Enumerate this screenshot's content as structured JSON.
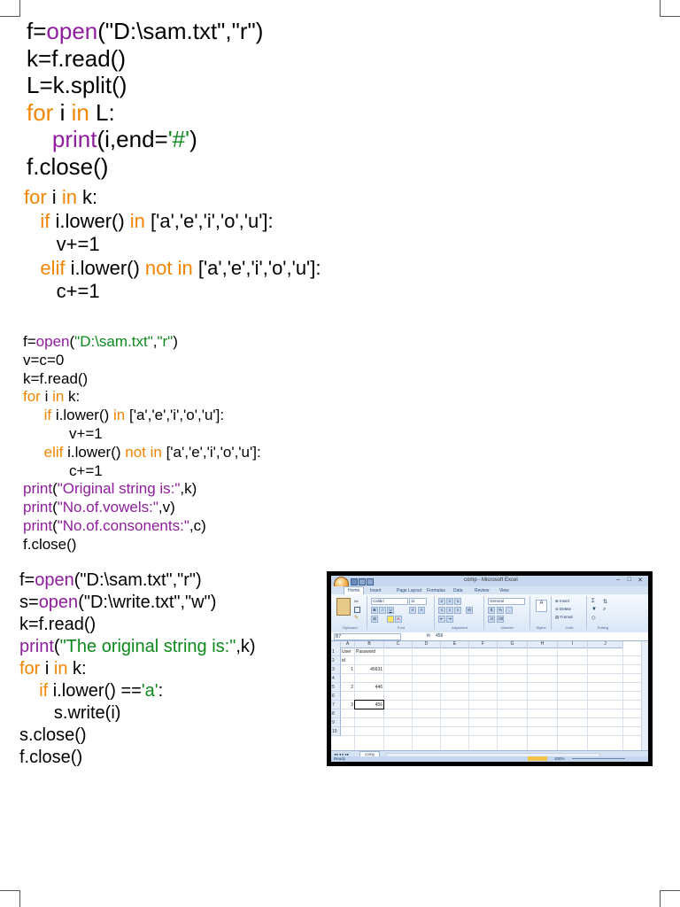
{
  "code_blocks": [
    {
      "lines": [
        [
          {
            "t": "f=",
            "c": "k"
          },
          {
            "t": "open",
            "c": "fn"
          },
          {
            "t": "(\"D:\\sam.txt\",\"r\")",
            "c": "k"
          }
        ],
        [
          {
            "t": "k=f.read()",
            "c": "k"
          }
        ],
        [
          {
            "t": "L=k.split()",
            "c": "k"
          }
        ],
        [
          {
            "t": "for",
            "c": "kw"
          },
          {
            "t": " i ",
            "c": "k"
          },
          {
            "t": "in",
            "c": "kw"
          },
          {
            "t": " L:",
            "c": "k"
          }
        ],
        [
          {
            "t": "    ",
            "c": "k"
          },
          {
            "t": "print",
            "c": "fn"
          },
          {
            "t": "(i,end=",
            "c": "k"
          },
          {
            "t": "'#'",
            "c": "str"
          },
          {
            "t": ")",
            "c": "k"
          }
        ],
        [
          {
            "t": "f.close()",
            "c": "k"
          }
        ]
      ]
    },
    {
      "lines": [
        [
          {
            "t": "for",
            "c": "kw"
          },
          {
            "t": " i ",
            "c": "k"
          },
          {
            "t": "in",
            "c": "kw"
          },
          {
            "t": " k:",
            "c": "k"
          }
        ],
        [
          {
            "t": "   ",
            "c": "k"
          },
          {
            "t": "if",
            "c": "kw"
          },
          {
            "t": " i.lower() ",
            "c": "k"
          },
          {
            "t": "in",
            "c": "kw"
          },
          {
            "t": " ['a','e','i','o','u']:",
            "c": "k"
          }
        ],
        [
          {
            "t": "      v+=1",
            "c": "k"
          }
        ],
        [
          {
            "t": "   ",
            "c": "k"
          },
          {
            "t": "elif",
            "c": "kw"
          },
          {
            "t": " i.lower() ",
            "c": "k"
          },
          {
            "t": "not in",
            "c": "kw"
          },
          {
            "t": " ['a','e','i','o','u']:",
            "c": "k"
          }
        ],
        [
          {
            "t": "      c+=1",
            "c": "k"
          }
        ]
      ]
    },
    {
      "lines": [
        [
          {
            "t": "f=",
            "c": "k"
          },
          {
            "t": "open",
            "c": "fn"
          },
          {
            "t": "(",
            "c": "k"
          },
          {
            "t": "\"D:\\sam.txt\"",
            "c": "str"
          },
          {
            "t": ",",
            "c": "k"
          },
          {
            "t": "\"r\"",
            "c": "str"
          },
          {
            "t": ")",
            "c": "k"
          }
        ],
        [
          {
            "t": "v=c=0",
            "c": "k"
          }
        ],
        [
          {
            "t": "k=f.read()",
            "c": "k"
          }
        ],
        [
          {
            "t": "for",
            "c": "kw"
          },
          {
            "t": " i ",
            "c": "k"
          },
          {
            "t": "in",
            "c": "kw"
          },
          {
            "t": " k:",
            "c": "k"
          }
        ],
        [
          {
            "t": "     ",
            "c": "k"
          },
          {
            "t": "if",
            "c": "kw"
          },
          {
            "t": " i.lower() ",
            "c": "k"
          },
          {
            "t": "in",
            "c": "kw"
          },
          {
            "t": " ['a','e','i','o','u']:",
            "c": "k"
          }
        ],
        [
          {
            "t": "           v+=1",
            "c": "k"
          }
        ],
        [
          {
            "t": "     ",
            "c": "k"
          },
          {
            "t": "elif",
            "c": "kw"
          },
          {
            "t": " i.lower() ",
            "c": "k"
          },
          {
            "t": "not in",
            "c": "kw"
          },
          {
            "t": " ['a','e','i','o','u']:",
            "c": "k"
          }
        ],
        [
          {
            "t": "           c+=1",
            "c": "k"
          }
        ],
        [
          {
            "t": "print",
            "c": "fn"
          },
          {
            "t": "(",
            "c": "k"
          },
          {
            "t": "\"Original string is:\"",
            "c": "fn"
          },
          {
            "t": ",k)",
            "c": "k"
          }
        ],
        [
          {
            "t": "print",
            "c": "fn"
          },
          {
            "t": "(",
            "c": "k"
          },
          {
            "t": "\"No.of.vowels:\"",
            "c": "fn"
          },
          {
            "t": ",v)",
            "c": "k"
          }
        ],
        [
          {
            "t": "print",
            "c": "fn"
          },
          {
            "t": "(",
            "c": "k"
          },
          {
            "t": "\"No.of.consonents:\"",
            "c": "fn"
          },
          {
            "t": ",c)",
            "c": "k"
          }
        ],
        [
          {
            "t": "f.close()",
            "c": "k"
          }
        ]
      ]
    },
    {
      "lines": [
        [
          {
            "t": "f=",
            "c": "k"
          },
          {
            "t": "open",
            "c": "fn"
          },
          {
            "t": "(\"D:\\sam.txt\",\"r\")",
            "c": "k"
          }
        ],
        [
          {
            "t": "s=",
            "c": "k"
          },
          {
            "t": "open",
            "c": "fn"
          },
          {
            "t": "(\"D:\\write.txt\",\"w\")",
            "c": "k"
          }
        ],
        [
          {
            "t": "k=f.read()",
            "c": "k"
          }
        ],
        [
          {
            "t": "print",
            "c": "fn"
          },
          {
            "t": "(",
            "c": "k"
          },
          {
            "t": "\"The original string is:\"",
            "c": "str"
          },
          {
            "t": ",k)",
            "c": "k"
          }
        ],
        [
          {
            "t": "for",
            "c": "kw"
          },
          {
            "t": " i ",
            "c": "k"
          },
          {
            "t": "in",
            "c": "kw"
          },
          {
            "t": " k:",
            "c": "k"
          }
        ],
        [
          {
            "t": "    ",
            "c": "k"
          },
          {
            "t": "if",
            "c": "kw"
          },
          {
            "t": " i.lower() ==",
            "c": "k"
          },
          {
            "t": "'a'",
            "c": "str"
          },
          {
            "t": ":",
            "c": "k"
          }
        ],
        [
          {
            "t": "       s.write(i)",
            "c": "k"
          }
        ],
        [
          {
            "t": "s.close()",
            "c": "k"
          }
        ],
        [
          {
            "t": "f.close()",
            "c": "k"
          }
        ]
      ]
    }
  ],
  "excel": {
    "window_title": "comp - Microsoft Excel",
    "ribbon_tabs": [
      "Home",
      "Insert",
      "Page Layout",
      "Formulas",
      "Data",
      "Review",
      "View"
    ],
    "font_name": "Calibri",
    "font_size": "11",
    "number_format": "General",
    "group_labels": [
      "Clipboard",
      "Font",
      "Alignment",
      "Number",
      "Styles",
      "Cells",
      "Editing"
    ],
    "cells_buttons": [
      "Insert",
      "Delete",
      "Format"
    ],
    "name_box": "B7",
    "formula_value": "456",
    "column_headers": [
      "A",
      "B",
      "C",
      "D",
      "E",
      "F",
      "G",
      "H",
      "I",
      "J"
    ],
    "row_headers": [
      "1",
      "2",
      "3",
      "4",
      "5",
      "6",
      "7",
      "8",
      "9",
      "10"
    ],
    "cells": {
      "header_a": "User id",
      "header_b": "Password",
      "r3_a": "1",
      "r3_b": "45631",
      "r5_a": "2",
      "r5_b": "446",
      "r7_a": "3",
      "r7_b": "456"
    },
    "sheet_tab": "comp",
    "status_left": "Ready",
    "zoom": "100%"
  }
}
